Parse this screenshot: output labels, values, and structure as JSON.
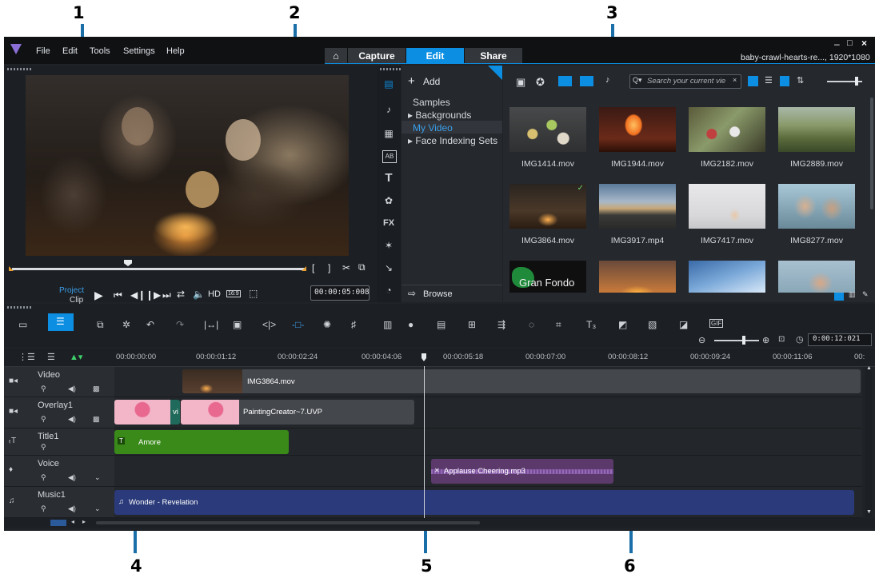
{
  "callouts": [
    "1",
    "2",
    "3",
    "4",
    "5",
    "6"
  ],
  "menu": {
    "file": "File",
    "edit": "Edit",
    "tools": "Tools",
    "settings": "Settings",
    "help": "Help"
  },
  "tabs": {
    "capture": "Capture",
    "edit": "Edit",
    "share": "Share"
  },
  "window": {
    "project_info": "baby-crawl-hearts-re..., 1920*1080"
  },
  "player": {
    "mode_project": "Project",
    "mode_clip": "Clip",
    "hd": "HD",
    "aspect": "16:9",
    "timecode": "00:00:05:008"
  },
  "library": {
    "add_label": "Add",
    "browse_label": "Browse",
    "search_placeholder": "Search your current vie",
    "folders": [
      "Samples",
      "Backgrounds",
      "My Video",
      "Face Indexing Sets"
    ],
    "items": [
      "IMG1414.mov",
      "IMG1944.mov",
      "IMG2182.mov",
      "IMG2889.mov",
      "IMG3864.mov",
      "IMG3917.mp4",
      "IMG7417.mov",
      "IMG8277.mov",
      "Gran Fondo"
    ]
  },
  "timeline": {
    "zoom_timecode": "0:00:12:021",
    "ruler": [
      "00:00:00:00",
      "00:00:01:12",
      "00:00:02:24",
      "00:00:04:06",
      "00:00:05:18",
      "00:00:07:00",
      "00:00:08:12",
      "00:00:09:24",
      "00:00:11:06",
      "00:"
    ],
    "tracks": [
      "Video",
      "Overlay1",
      "Title1",
      "Voice",
      "Music1"
    ],
    "clips": {
      "video": "IMG3864.mov",
      "overlay_small": "vi",
      "overlay": "PaintingCreator~7.UVP",
      "title": "Amore",
      "voice": "Applause Cheering.mp3",
      "music": "Wonder - Revelation"
    }
  },
  "colors": {
    "accent": "#0c8fe3",
    "callout_arrow": "#1a6fa8",
    "title_clip": "#3a8a1a",
    "voice_clip": "#5b3a6b",
    "music_clip": "#2a3a7a",
    "overlay_clip": "#f0a8c0"
  }
}
